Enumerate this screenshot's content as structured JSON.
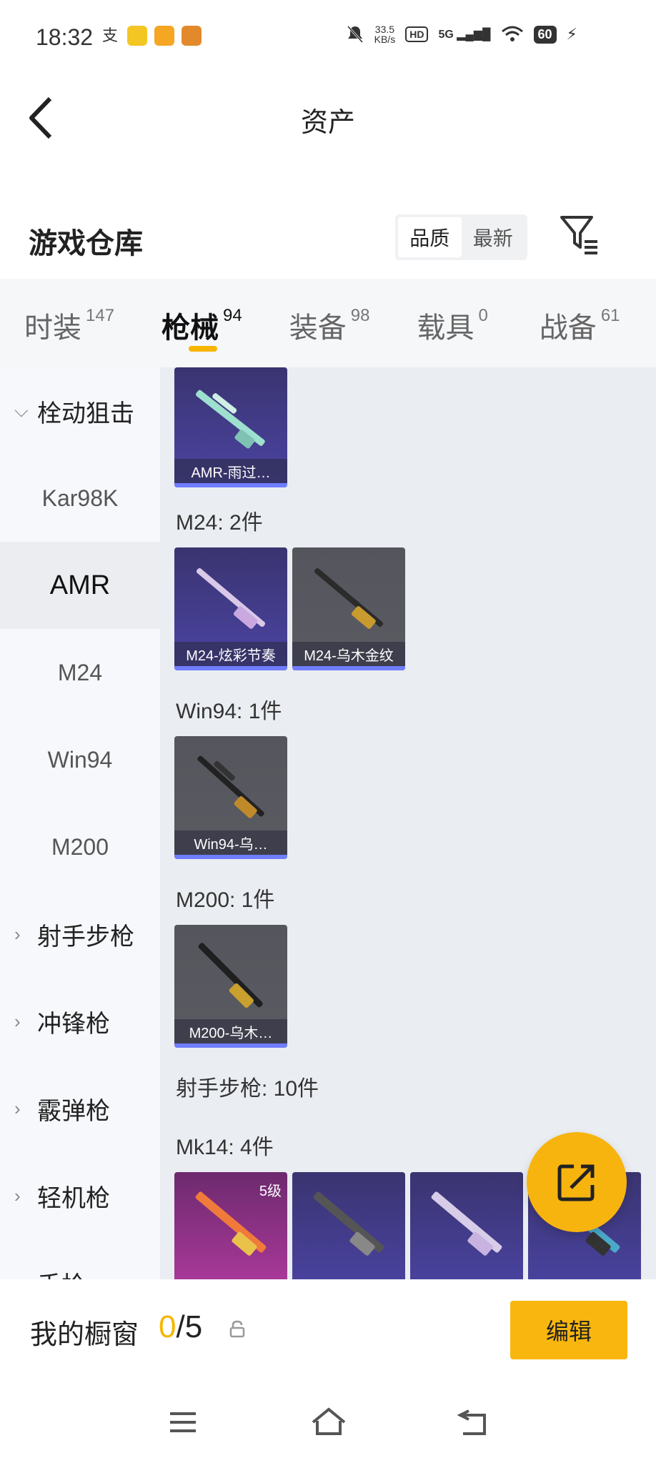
{
  "status_bar": {
    "time": "18:32",
    "net_speed_value": "33.5",
    "net_speed_unit": "KB/s",
    "hd": "HD",
    "signal": "5G",
    "battery": "60"
  },
  "header": {
    "title": "资产"
  },
  "warehouse": {
    "label": "游戏仓库",
    "sort_options": [
      {
        "label": "品质"
      },
      {
        "label": "最新"
      }
    ],
    "active_sort": "品质"
  },
  "tabs": [
    {
      "name": "时装",
      "count": "147"
    },
    {
      "name": "枪械",
      "count": "94"
    },
    {
      "name": "装备",
      "count": "98"
    },
    {
      "name": "载具",
      "count": "0"
    },
    {
      "name": "战备",
      "count": "61"
    }
  ],
  "active_tab": "枪械",
  "sidebar": [
    {
      "label": "栓动狙击",
      "type": "group",
      "expanded": true
    },
    {
      "label": "Kar98K",
      "type": "item"
    },
    {
      "label": "AMR",
      "type": "item",
      "active": true
    },
    {
      "label": "M24",
      "type": "item"
    },
    {
      "label": "Win94",
      "type": "item"
    },
    {
      "label": "M200",
      "type": "item"
    },
    {
      "label": "射手步枪",
      "type": "group"
    },
    {
      "label": "冲锋枪",
      "type": "group"
    },
    {
      "label": "霰弹枪",
      "type": "group"
    },
    {
      "label": "轻机枪",
      "type": "group"
    },
    {
      "label": "手枪",
      "type": "group"
    }
  ],
  "content": {
    "sections": [
      {
        "title": "M24: 2件"
      },
      {
        "title": "Win94: 1件"
      },
      {
        "title": "M200: 1件"
      },
      {
        "title": "射手步枪: 10件"
      },
      {
        "title": "Mk14: 4件"
      }
    ],
    "cards": [
      {
        "name": "AMR-雨过…",
        "style": "purple"
      },
      {
        "name": "M24-炫彩节奏",
        "style": "purple"
      },
      {
        "name": "M24-乌木金纹",
        "style": "gray"
      },
      {
        "name": "Win94-乌…",
        "style": "gray"
      },
      {
        "name": "M200-乌木…",
        "style": "gray"
      },
      {
        "name": "",
        "style": "pink",
        "level": "5级"
      },
      {
        "name": "",
        "style": "purple"
      },
      {
        "name": "",
        "style": "purple"
      },
      {
        "name": "",
        "style": "purple"
      }
    ]
  },
  "showcase": {
    "label": "我的橱窗",
    "current": "0",
    "separator": "/",
    "total": "5",
    "edit_label": "编辑"
  },
  "colors": {
    "accent": "#f8b60e",
    "rarity_bar": "#6f7dff"
  },
  "icons": {
    "back": "back-arrow-icon",
    "filter": "filter-icon",
    "share": "share-icon",
    "lock": "lock-icon",
    "nav": [
      "menu-icon",
      "home-icon",
      "back-icon"
    ]
  }
}
